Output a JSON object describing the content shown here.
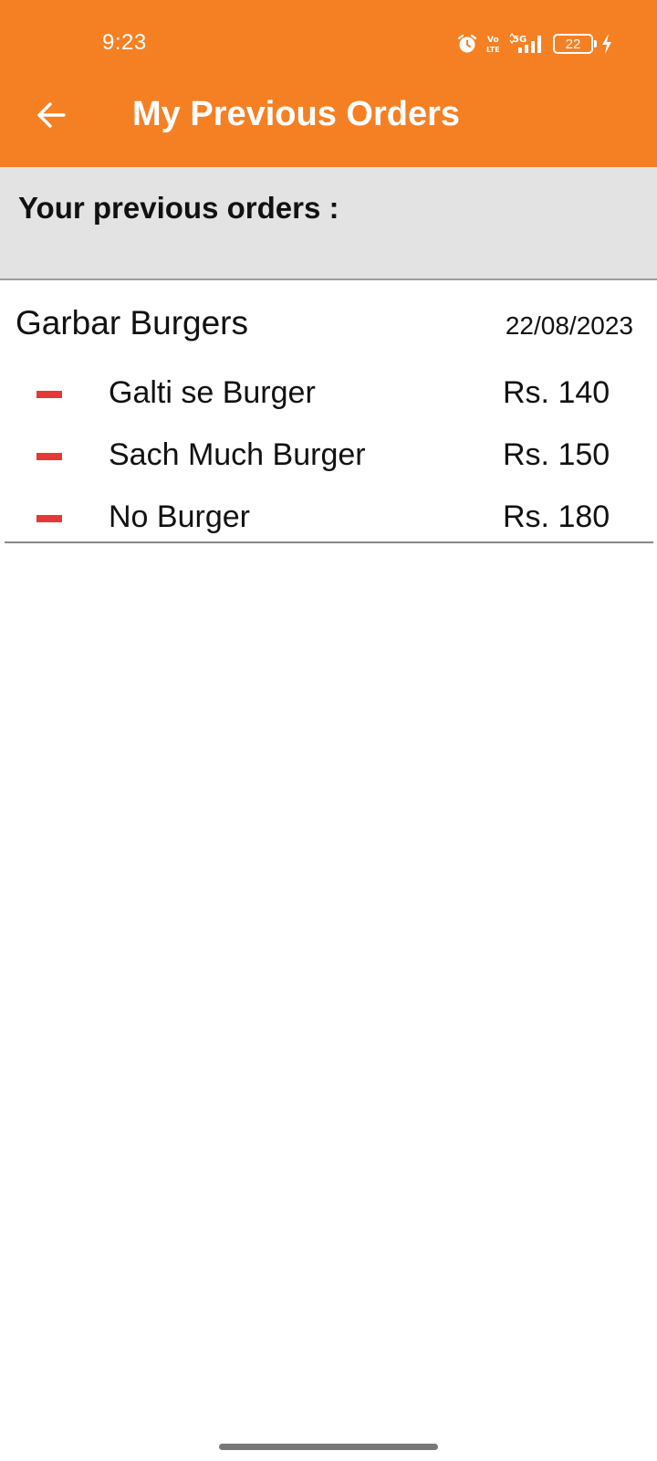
{
  "status_bar": {
    "time": "9:23",
    "network": "5G",
    "volte": "Vo LTE",
    "battery": "22",
    "icons": [
      "alarm-icon",
      "volte-icon",
      "signal-5g-icon",
      "battery-icon",
      "charging-icon"
    ]
  },
  "app_bar": {
    "title": "My Previous Orders",
    "back_icon": "arrow-back-icon",
    "color": "#F58024"
  },
  "section": {
    "header": "Your previous orders :"
  },
  "orders": [
    {
      "restaurant": "Garbar Burgers",
      "date": "22/08/2023",
      "items": [
        {
          "name": "Galti se Burger",
          "price": "Rs. 140"
        },
        {
          "name": "Sach Much Burger",
          "price": "Rs. 150"
        },
        {
          "name": "No Burger",
          "price": "Rs. 180"
        }
      ]
    }
  ],
  "colors": {
    "accent": "#F58024",
    "item_marker": "#E53935",
    "header_bg": "#E3E3E3"
  }
}
